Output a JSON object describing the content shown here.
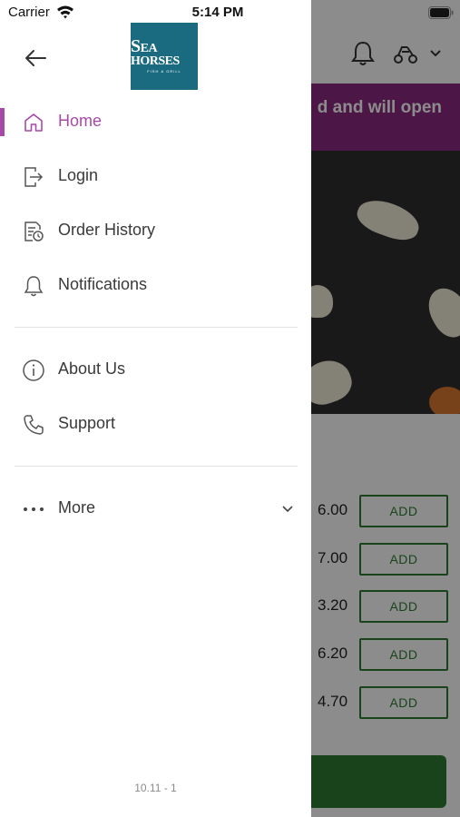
{
  "status_bar": {
    "carrier": "Carrier",
    "time": "5:14 PM"
  },
  "drawer": {
    "logo": {
      "line1_initial": "S",
      "line1_rest": "EA HORSES",
      "line2": "FISH & GRILL"
    },
    "menu": [
      {
        "label": "Home",
        "icon": "home-icon",
        "active": true
      },
      {
        "label": "Login",
        "icon": "login-icon",
        "active": false
      },
      {
        "label": "Order History",
        "icon": "order-history-icon",
        "active": false
      },
      {
        "label": "Notifications",
        "icon": "bell-icon",
        "active": false
      },
      {
        "label": "About Us",
        "icon": "info-icon",
        "active": false
      },
      {
        "label": "Support",
        "icon": "phone-icon",
        "active": false
      },
      {
        "label": "More",
        "icon": "more-icon",
        "active": false
      }
    ],
    "version": "10.11 - 1",
    "accent_color": "#a64aa6"
  },
  "background": {
    "banner_text": "d and will open",
    "banner_color": "#8b2a82",
    "items": [
      {
        "price": "6.00",
        "button": "ADD"
      },
      {
        "price": "7.00",
        "button": "ADD"
      },
      {
        "price": "3.20",
        "button": "ADD"
      },
      {
        "price": "6.20",
        "button": "ADD"
      },
      {
        "price": "4.70",
        "button": "ADD"
      }
    ],
    "button_color": "#2e7d32"
  }
}
